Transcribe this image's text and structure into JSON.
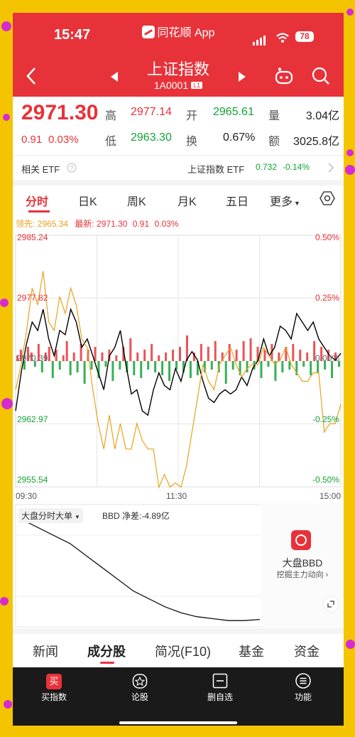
{
  "status_bar": {
    "time": "15:47",
    "app_name": "同花顺 App",
    "battery": "78"
  },
  "nav": {
    "title": "上证指数",
    "code": "1A0001",
    "level_badge": "L1"
  },
  "quote": {
    "price": "2971.30",
    "change": "0.91",
    "change_pct": "0.03%",
    "high_label": "高",
    "high": "2977.14",
    "open_label": "开",
    "open": "2965.61",
    "volume_label": "量",
    "volume": "3.04亿",
    "low_label": "低",
    "low": "2963.30",
    "turnover_label": "换",
    "turnover": "0.67%",
    "amount_label": "额",
    "amount": "3025.8亿"
  },
  "etf": {
    "label": "相关 ETF",
    "name": "上证指数 ETF",
    "price": "0.732",
    "change": "-0.14%"
  },
  "tabs": [
    "分时",
    "日K",
    "周K",
    "月K",
    "五日",
    "更多"
  ],
  "legend": {
    "leader": "领先: 2965.34",
    "latest": "最新: 2971.30",
    "change": "0.91",
    "change_pct": "0.03%"
  },
  "chart_data": {
    "type": "line",
    "y_ticks_left": [
      "2985.24",
      "2977.82",
      "2970.39",
      "2962.97",
      "2955.54"
    ],
    "y_ticks_right": [
      "0.50%",
      "0.25%",
      "0.00%",
      "-0.25%",
      "-0.50%"
    ],
    "x_ticks": [
      "09:30",
      "11:30",
      "15:00"
    ],
    "ylim": [
      2955.54,
      2985.24
    ],
    "series": [
      {
        "name": "最新",
        "color": "#000000",
        "values": [
          2964.5,
          2969,
          2972.5,
          2975,
          2974,
          2976.5,
          2973,
          2971,
          2974,
          2973.5,
          2976.5,
          2975,
          2972,
          2973,
          2971,
          2969,
          2967,
          2971,
          2972,
          2974,
          2970,
          2966.5,
          2967,
          2964.5,
          2964,
          2967,
          2969,
          2967.5,
          2967,
          2969.5,
          2968,
          2970.5,
          2971.5,
          2970.5,
          2968,
          2966,
          2965.5,
          2966.5,
          2967,
          2966.5,
          2967,
          2968.5,
          2967.5,
          2969.5,
          2970.5,
          2973,
          2971,
          2972,
          2974.5,
          2974,
          2973,
          2976,
          2975,
          2974,
          2975,
          2973,
          2972,
          2971,
          2970.5,
          2971.3
        ]
      },
      {
        "name": "领先",
        "color": "#e8a21c",
        "values": [
          2967,
          2970,
          2974,
          2979,
          2977,
          2981,
          2975,
          2974,
          2978,
          2976,
          2979,
          2977,
          2973,
          2972,
          2967,
          2963,
          2960,
          2964,
          2960,
          2963,
          2960,
          2960,
          2963,
          2961,
          2960,
          2960,
          2955.5,
          2957,
          2955.5,
          2956,
          2955.5,
          2958,
          2962,
          2966,
          2970,
          2968,
          2967,
          2970,
          2971,
          2972,
          2970,
          2968.5,
          2969.5,
          2970,
          2970,
          2972,
          2971,
          2970,
          2970.5,
          2972,
          2970,
          2969,
          2968,
          2968,
          2969,
          2969,
          2962,
          2963,
          2963,
          2965.3
        ]
      }
    ],
    "volume_bars": [
      2,
      4,
      -3,
      5,
      3,
      -2,
      6,
      -4,
      3,
      5,
      -6,
      4,
      -3,
      2,
      7,
      -5,
      3,
      -4,
      6,
      -8,
      4,
      -3,
      5,
      -6,
      3,
      -2,
      4,
      -7,
      2,
      -3,
      5,
      -4,
      8,
      -5,
      3,
      -6,
      4,
      -3,
      6,
      -4,
      2,
      -5,
      3,
      -7,
      4,
      -3,
      5,
      -4,
      9,
      -6,
      3,
      -5,
      6,
      -4,
      5,
      -3,
      7,
      -4,
      3,
      -8,
      6,
      -3,
      4,
      -5,
      7,
      -4,
      8,
      -3,
      5,
      -6,
      4,
      -2,
      6,
      -7,
      3,
      -4,
      5,
      -3,
      6,
      -5,
      4,
      -2,
      3,
      -5,
      7,
      -4,
      5,
      -3,
      4,
      -6,
      3,
      -2
    ],
    "grid": true
  },
  "bbd": {
    "selector": "大盘分时大单",
    "label": "BBD 净差:-4.89亿",
    "values": [
      0,
      -2,
      -4,
      -6,
      -9,
      -12,
      -15,
      -18,
      -20,
      -22,
      -23.5,
      -24.5,
      -25,
      -25.5,
      -25.5,
      -25.2
    ]
  },
  "bbd_card": {
    "title": "大盘BBD",
    "subtitle": "挖掘主力动向"
  },
  "bottom_tabs": [
    "新闻",
    "成分股",
    "简况(F10)",
    "基金",
    "资金"
  ],
  "bottom_nav": [
    "买指数",
    "论股",
    "删自选",
    "功能"
  ],
  "colors": {
    "header": "#e8323a",
    "up": "#e8323a",
    "down": "#12a336",
    "leader": "#e8a21c",
    "nav_bg": "#1a1a1a"
  }
}
